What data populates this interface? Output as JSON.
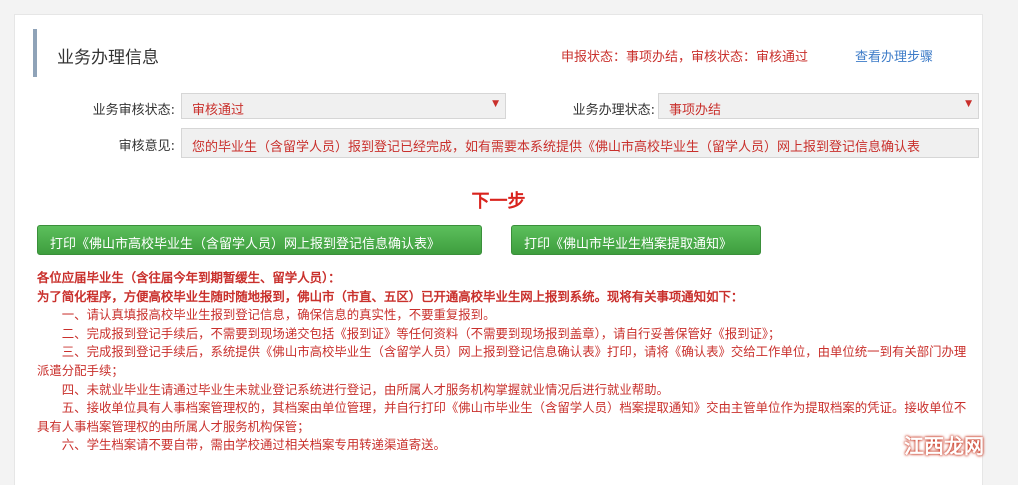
{
  "section": {
    "title": "业务办理信息",
    "status": "申报状态：事项办结，审核状态：审核通过",
    "steps_link": "查看办理步骤"
  },
  "form": {
    "review_status_label": "业务审核状态:",
    "review_status_value": "审核通过",
    "process_status_label": "业务办理状态:",
    "process_status_value": "事项办结",
    "opinion_label": "审核意见:",
    "opinion_value": "您的毕业生（含留学人员）报到登记已经完成，如有需要本系统提供《佛山市高校毕业生（留学人员）网上报到登记信息确认表"
  },
  "next_step": "下一步",
  "buttons": {
    "print_confirm": "打印《佛山市高校毕业生（含留学人员）网上报到登记信息确认表》",
    "print_archive": "打印《佛山市毕业生档案提取通知》"
  },
  "notice": {
    "heading1": "各位应届毕业生（含往届今年到期暂缓生、留学人员）：",
    "heading2": "为了简化程序，方便高校毕业生随时随地报到，佛山市（市直、五区）已开通高校毕业生网上报到系统。现将有关事项通知如下：",
    "items": [
      "一、请认真填报高校毕业生报到登记信息，确保信息的真实性，不要重复报到。",
      "二、完成报到登记手续后，不需要到现场递交包括《报到证》等任何资料（不需要到现场报到盖章），请自行妥善保管好《报到证》；",
      "三、完成报到登记手续后，系统提供《佛山市高校毕业生（含留学人员）网上报到登记信息确认表》打印，请将《确认表》交给工作单位，由单位统一到有关部门办理派遣分配手续；",
      "四、未就业毕业生请通过毕业生未就业登记系统进行登记，由所属人才服务机构掌握就业情况后进行就业帮助。",
      "五、接收单位具有人事档案管理权的，其档案由单位管理，并自行打印《佛山市毕业生（含留学人员）档案提取通知》交由主管单位作为提取档案的凭证。接收单位不具有人事档案管理权的由所属人才服务机构保管；",
      "六、学生档案请不要自带，需由学校通过相关档案专用转递渠道寄送。"
    ]
  },
  "watermark": "江西龙网",
  "colors": {
    "accent_red": "#c9302c",
    "link_blue": "#3e7cc8",
    "button_green": "#4cae4c"
  }
}
